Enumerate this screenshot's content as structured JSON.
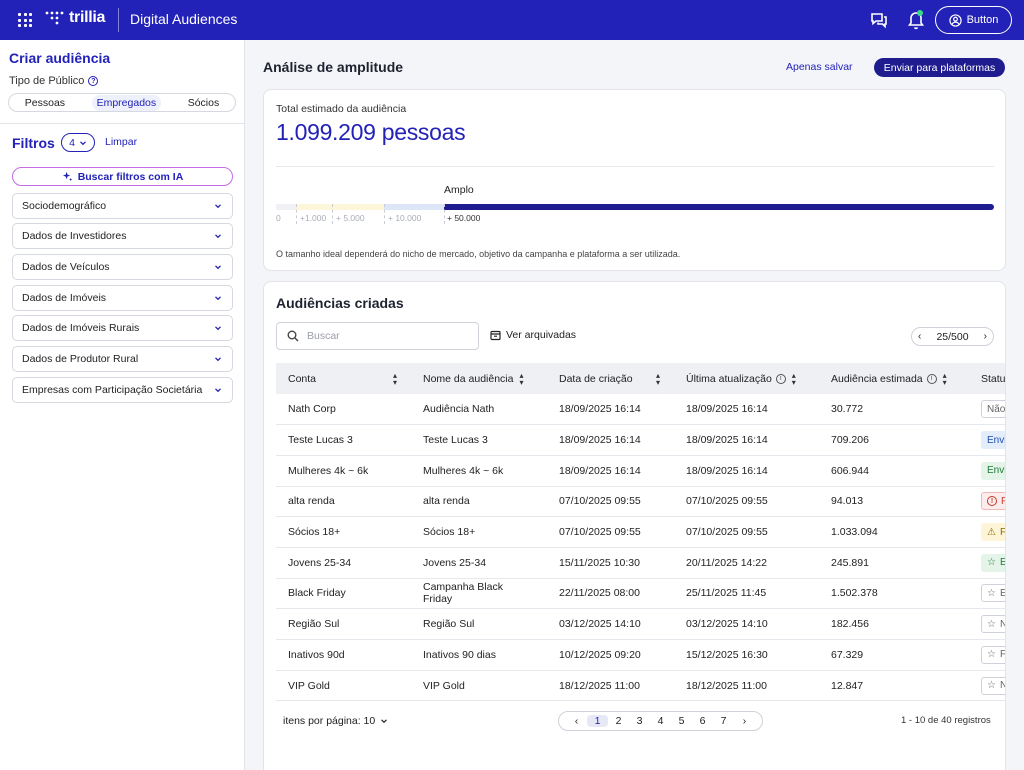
{
  "topbar": {
    "logo_text": "trillia",
    "app_name": "Digital Audiences",
    "user_button": "Button"
  },
  "sidebar": {
    "title": "Criar audiência",
    "public_type_label": "Tipo de Público",
    "segments": [
      "Pessoas",
      "Empregados",
      "Sócios"
    ],
    "active_segment": "Empregados",
    "filters_label": "Filtros",
    "filters_count": "4",
    "clear_label": "Limpar",
    "ai_button": "Buscar filtros com IA",
    "accordions": [
      "Sociodemográfico",
      "Dados de Investidores",
      "Dados de Veículos",
      "Dados de Imóveis",
      "Dados de Imóveis Rurais",
      "Dados de Produtor Rural",
      "Empresas com Participação Societária"
    ]
  },
  "header": {
    "title": "Análise de amplitude",
    "save_link": "Apenas salvar",
    "send_button": "Enviar para plataformas"
  },
  "amplitude": {
    "label": "Total estimado da audiência",
    "value": "1.099.209 pessoas",
    "level_label": "Amplo",
    "ticks": [
      "0",
      "+1.000",
      "+ 5.000",
      "+ 10.000",
      "+ 50.000"
    ],
    "note": "O tamanho ideal dependerá do nicho de mercado, objetivo da campanha e plataforma a ser utilizada.",
    "colors": {
      "seg1": "#f0f1f4",
      "seg2": "#fdf6d8",
      "seg3": "#fdf6d8",
      "seg4": "#dde6f6",
      "seg5": "#1f1c8f"
    }
  },
  "audiences": {
    "title": "Audiências criadas",
    "search_placeholder": "Buscar",
    "archived_label": "Ver arquivadas",
    "page_indicator": "25/500",
    "columns": [
      "Conta",
      "Nome da audiência",
      "Data de criação",
      "Última atualização",
      "Audiência estimada",
      "Status"
    ],
    "rows": [
      {
        "account": "Nath Corp",
        "name": "Audiência Nath",
        "created": "18/09/2025 16:14",
        "updated": "18/09/2025 16:14",
        "estimate": "30.772",
        "status": "Não",
        "status_type": "neutral",
        "status_icon": ""
      },
      {
        "account": "Teste Lucas 3",
        "name": "Teste Lucas 3",
        "created": "18/09/2025 16:14",
        "updated": "18/09/2025 16:14",
        "estimate": "709.206",
        "status": "Envi",
        "status_type": "sent",
        "status_icon": ""
      },
      {
        "account": "Mulheres 4k ~ 6k",
        "name": "Mulheres 4k ~ 6k",
        "created": "18/09/2025 16:14",
        "updated": "18/09/2025 16:14",
        "estimate": "606.944",
        "status": "Envi",
        "status_type": "green",
        "status_icon": ""
      },
      {
        "account": "alta renda",
        "name": "alta renda",
        "created": "07/10/2025 09:55",
        "updated": "07/10/2025 09:55",
        "estimate": "94.013",
        "status": "F",
        "status_type": "red",
        "status_icon": "!"
      },
      {
        "account": "Sócios 18+",
        "name": "Sócios 18+",
        "created": "07/10/2025 09:55",
        "updated": "07/10/2025 09:55",
        "estimate": "1.033.094",
        "status": "F",
        "status_type": "warn",
        "status_icon": "⚠"
      },
      {
        "account": "Jovens 25-34",
        "name": "Jovens 25-34",
        "created": "15/11/2025 10:30",
        "updated": "20/11/2025 14:22",
        "estimate": "245.891",
        "status": "E",
        "status_type": "green",
        "status_icon": "☆"
      },
      {
        "account": "Black Friday",
        "name": "Campanha Black Friday",
        "created": "22/11/2025 08:00",
        "updated": "25/11/2025 11:45",
        "estimate": "1.502.378",
        "status": "E",
        "status_type": "neutral",
        "status_icon": "☆"
      },
      {
        "account": "Região Sul",
        "name": "Região Sul",
        "created": "03/12/2025 14:10",
        "updated": "03/12/2025 14:10",
        "estimate": "182.456",
        "status": "N",
        "status_type": "neutral",
        "status_icon": "☆"
      },
      {
        "account": "Inativos 90d",
        "name": "Inativos 90 dias",
        "created": "10/12/2025 09:20",
        "updated": "15/12/2025 16:30",
        "estimate": "67.329",
        "status": "F",
        "status_type": "neutral",
        "status_icon": "☆"
      },
      {
        "account": "VIP Gold",
        "name": "VIP Gold",
        "created": "18/12/2025 11:00",
        "updated": "18/12/2025 11:00",
        "estimate": "12.847",
        "status": "N",
        "status_type": "neutral",
        "status_icon": "☆"
      }
    ],
    "items_per_page": "itens por página: 10",
    "pages": [
      "1",
      "2",
      "3",
      "4",
      "5",
      "6",
      "7"
    ],
    "active_page": "1",
    "records": "1 - 10 de 40 registros"
  }
}
